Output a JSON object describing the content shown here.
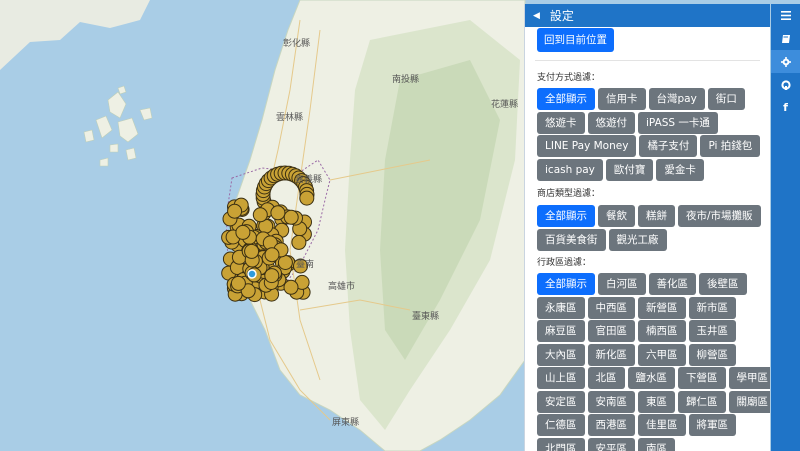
{
  "map": {
    "labels": {
      "changhua": "彰化縣",
      "nantou": "南投縣",
      "hualien": "花蓮縣",
      "yunlin": "雲林縣",
      "chiayi": "嘉義縣",
      "tainan": "臺南",
      "kaohsiung": "高雄市",
      "taitung": "臺東縣",
      "pingtung": "屏東縣"
    },
    "marker_color": "#c9a235",
    "location_color": "#2f9bdc"
  },
  "panel": {
    "title": "設定",
    "recenter_label": "回到目前位置",
    "payment_label": "支付方式過濾：",
    "payment_options": [
      [
        "全部顯示",
        "信用卡",
        "台灣pay",
        "街口"
      ],
      [
        "悠遊卡",
        "悠遊付",
        "iPASS 一卡通"
      ],
      [
        "LINE Pay Money",
        "橘子支付",
        "Pi 拍錢包"
      ],
      [
        "icash pay",
        "歐付寶",
        "愛金卡"
      ]
    ],
    "store_label": "商店類型過濾：",
    "store_options": [
      [
        "全部顯示",
        "餐飲",
        "糕餅",
        "夜市/市場攤販"
      ],
      [
        "百貨美食街",
        "觀光工廠"
      ]
    ],
    "district_label": "行政區過濾：",
    "district_options": [
      [
        "全部顯示",
        "白河區",
        "善化區",
        "後壁區"
      ],
      [
        "永康區",
        "中西區",
        "新營區",
        "新市區"
      ],
      [
        "麻豆區",
        "官田區",
        "楠西區",
        "玉井區"
      ],
      [
        "大內區",
        "新化區",
        "六甲區",
        "柳營區"
      ],
      [
        "山上區",
        "北區",
        "鹽水區",
        "下營區",
        "學甲區"
      ],
      [
        "安定區",
        "安南區",
        "東區",
        "歸仁區",
        "關廟區"
      ],
      [
        "仁德區",
        "西港區",
        "佳里區",
        "將軍區"
      ],
      [
        "北門區",
        "安平區",
        "南區"
      ]
    ]
  },
  "nav": {
    "icons": [
      "menu-icon",
      "book-icon",
      "gear-icon",
      "github-icon",
      "facebook-icon"
    ]
  }
}
